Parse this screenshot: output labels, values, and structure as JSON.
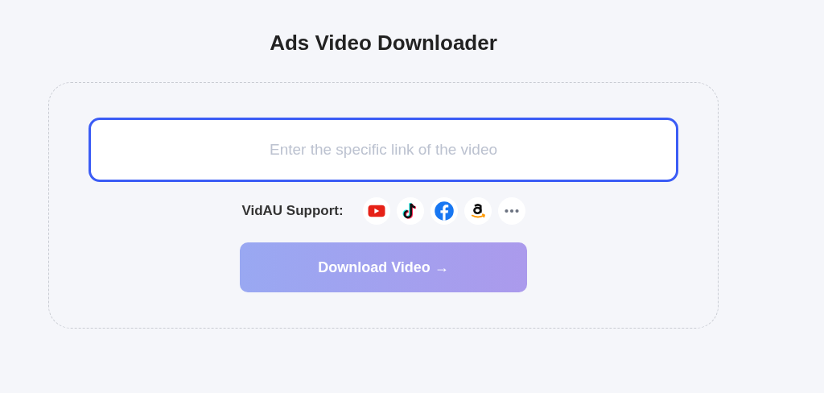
{
  "title": "Ads Video Downloader",
  "link_field": {
    "placeholder": "Enter the specific link of the video",
    "focused": true
  },
  "support": {
    "label": "VidAU Support:",
    "platforms": [
      {
        "kind": "youtube"
      },
      {
        "kind": "tiktok"
      },
      {
        "kind": "facebook"
      },
      {
        "kind": "amazon"
      },
      {
        "kind": "more"
      }
    ]
  },
  "download_button": {
    "label": "Download Video →",
    "disabled": true
  }
}
